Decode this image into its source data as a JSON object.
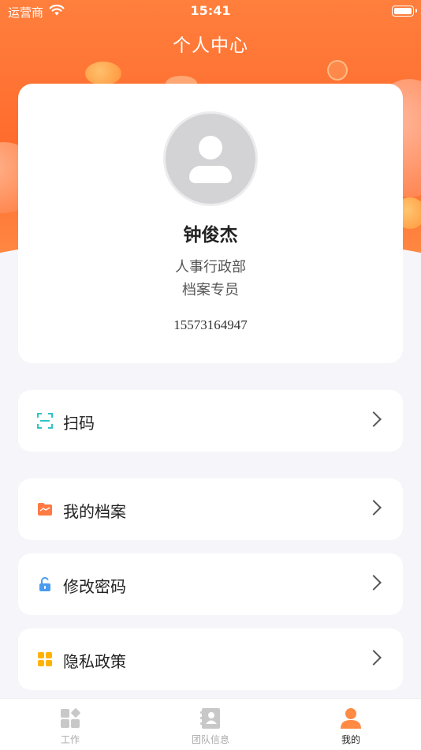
{
  "status_bar": {
    "carrier": "运营商",
    "time": "15:41"
  },
  "header": {
    "title": "个人中心"
  },
  "profile": {
    "name": "钟俊杰",
    "department": "人事行政部",
    "position": "档案专员",
    "phone": "15573164947"
  },
  "menu": [
    {
      "label": "扫码",
      "icon": "scan-icon",
      "color": "#2ec4c4"
    },
    {
      "label": "我的档案",
      "icon": "folder-icon",
      "color": "#ff7a45"
    },
    {
      "label": "修改密码",
      "icon": "unlock-icon",
      "color": "#4a9cf0"
    },
    {
      "label": "隐私政策",
      "icon": "grid-icon",
      "color": "#ffb300"
    }
  ],
  "tabbar": {
    "items": [
      {
        "label": "工作",
        "icon": "work-grid-icon",
        "active": false
      },
      {
        "label": "团队信息",
        "icon": "contacts-icon",
        "active": false
      },
      {
        "label": "我的",
        "icon": "person-icon",
        "active": true
      }
    ]
  },
  "colors": {
    "accent": "#ff6a2c",
    "active_tab_icon": "#ff8a44",
    "inactive_tab_icon": "#c8c8c8"
  }
}
